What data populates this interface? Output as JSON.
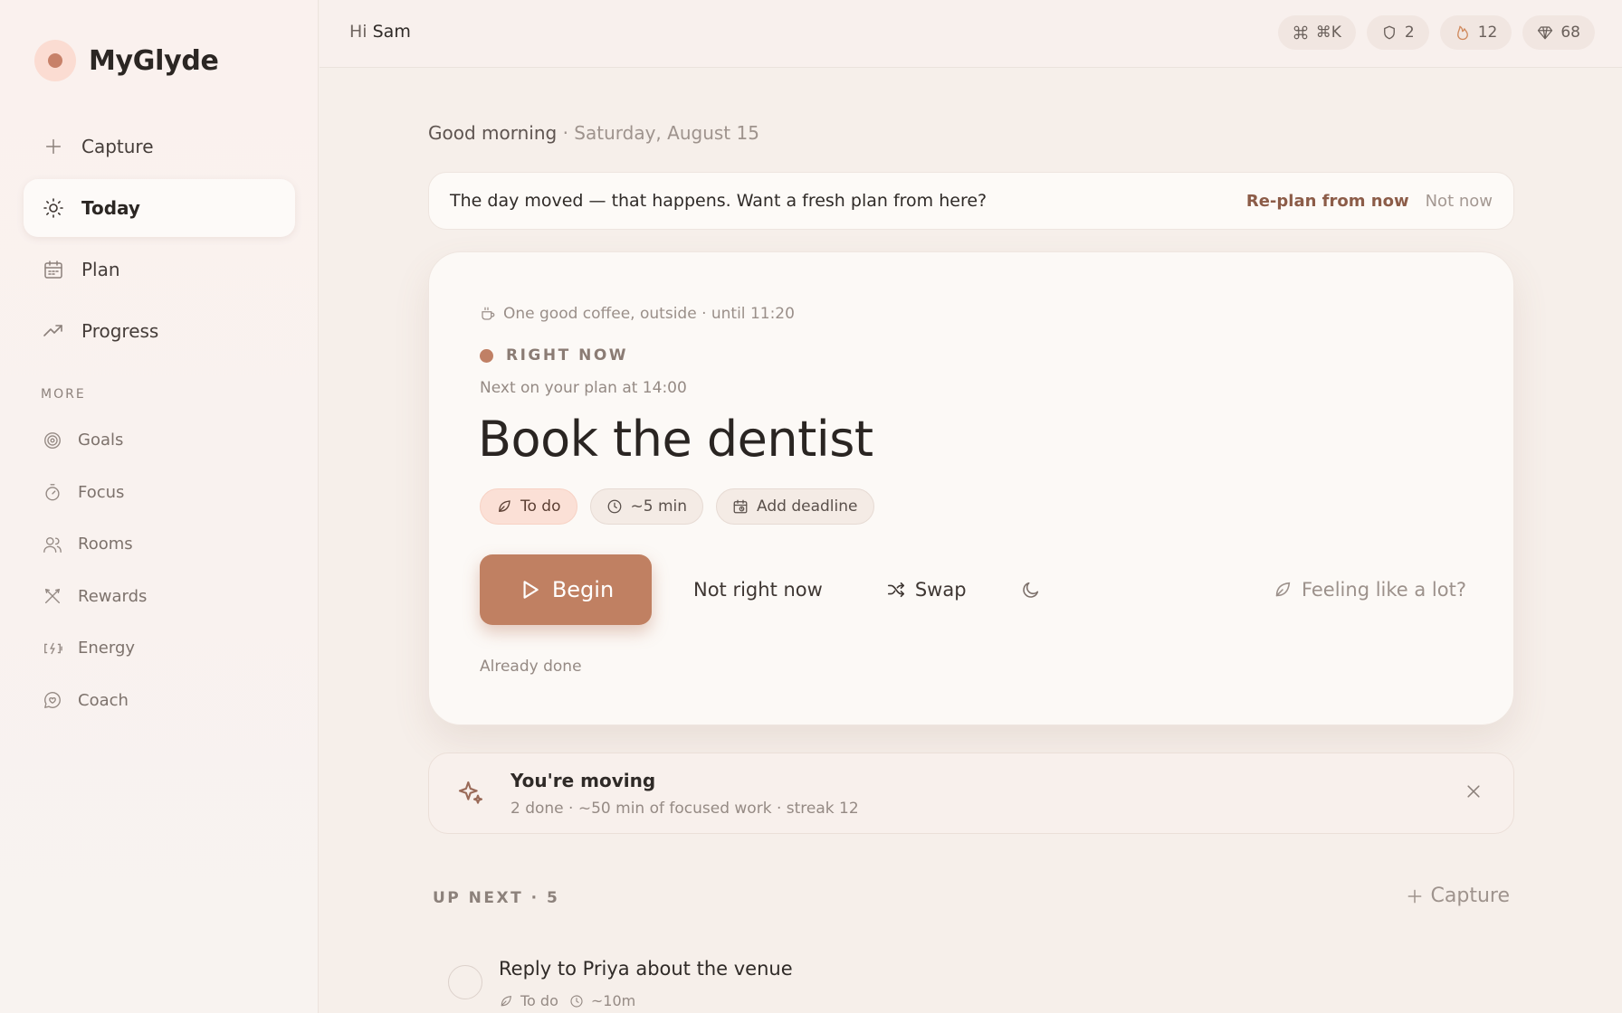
{
  "app": {
    "name": "MyGlyde"
  },
  "sidebar": {
    "items": [
      {
        "label": "Capture",
        "icon": "plus-icon"
      },
      {
        "label": "Today",
        "icon": "sun-icon"
      },
      {
        "label": "Plan",
        "icon": "calendar-icon"
      },
      {
        "label": "Progress",
        "icon": "trend-icon"
      }
    ],
    "more_label": "MORE",
    "more_items": [
      {
        "label": "Goals",
        "icon": "target-icon"
      },
      {
        "label": "Focus",
        "icon": "timer-icon"
      },
      {
        "label": "Rooms",
        "icon": "people-icon"
      },
      {
        "label": "Rewards",
        "icon": "rewards-icon"
      },
      {
        "label": "Energy",
        "icon": "battery-icon"
      },
      {
        "label": "Coach",
        "icon": "chat-heart-icon"
      }
    ]
  },
  "header": {
    "greeting_prefix": "Hi",
    "user_name": "Sam",
    "shortcut": "⌘K",
    "shield_count": "2",
    "streak_count": "12",
    "gem_count": "68"
  },
  "main": {
    "greeting": "Good morning",
    "date": "· Saturday, August 15",
    "banner": {
      "message": "The day moved — that happens. Want a fresh plan from here?",
      "replan_label": "Re-plan from now",
      "dismiss_label": "Not now"
    },
    "card": {
      "context": "One good coffee, outside · until 11:20",
      "now_label": "RIGHT NOW",
      "next_text": "Next on your plan at 14:00",
      "title": "Book the dentist",
      "chips": {
        "status": "To do",
        "estimate": "~5 min",
        "deadline": "Add deadline"
      },
      "begin_label": "Begin",
      "not_now_label": "Not right now",
      "swap_label": "Swap",
      "feeling_label": "Feeling like a lot?",
      "already_done_label": "Already done"
    },
    "moving": {
      "title": "You're moving",
      "subtitle": "2 done · ~50 min of focused work · streak 12"
    },
    "up_next": {
      "label": "UP NEXT · 5",
      "capture_label": "Capture",
      "items": [
        {
          "title": "Reply to Priya about the venue",
          "status": "To do",
          "estimate": "~10m"
        }
      ]
    }
  },
  "colors": {
    "accent": "#c08062",
    "background": "#f6efea",
    "card": "#fcf9f6"
  }
}
